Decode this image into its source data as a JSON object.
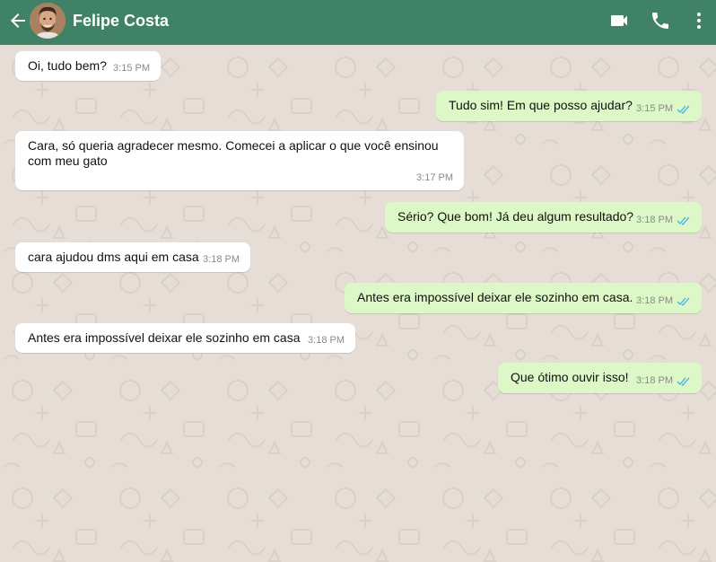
{
  "header": {
    "contact_name": "Felipe Costa",
    "icons": [
      "back-arrow-icon",
      "avatar",
      "video-call-icon",
      "phone-icon",
      "more-vert-icon"
    ],
    "background_color": "#3f8268"
  },
  "chat": {
    "wallpaper_color": "#e6ded6",
    "incoming_bubble_color": "#ffffff",
    "outgoing_bubble_color": "#dcf8c6",
    "read_tick_color": "#4fb6ec",
    "messages": [
      {
        "direction": "in",
        "text": "Oi, tudo bem?",
        "time": "3:15 PM"
      },
      {
        "direction": "out",
        "text": "Tudo sim! Em que posso ajudar?",
        "time": "3:15 PM",
        "status": "read"
      },
      {
        "direction": "in",
        "text": "Cara, só queria agradecer mesmo. Comecei a aplicar o que você ensinou\ncom meu gato",
        "time": "3:17 PM"
      },
      {
        "direction": "out",
        "text": "Sério? Que bom! Já deu algum resultado?",
        "time": "3:18 PM",
        "status": "read"
      },
      {
        "direction": "in",
        "text": "cara ajudou dms aqui em casa",
        "time": "3:18 PM"
      },
      {
        "direction": "out",
        "text": "Antes era impossível deixar ele sozinho em casa.",
        "time": "3:18 PM",
        "status": "read"
      },
      {
        "direction": "in",
        "text": "Antes era impossível deixar ele sozinho em casa",
        "time": "3:18 PM"
      },
      {
        "direction": "out",
        "text": "Que ótimo ouvir isso!",
        "time": "3:18 PM",
        "status": "read"
      }
    ]
  }
}
